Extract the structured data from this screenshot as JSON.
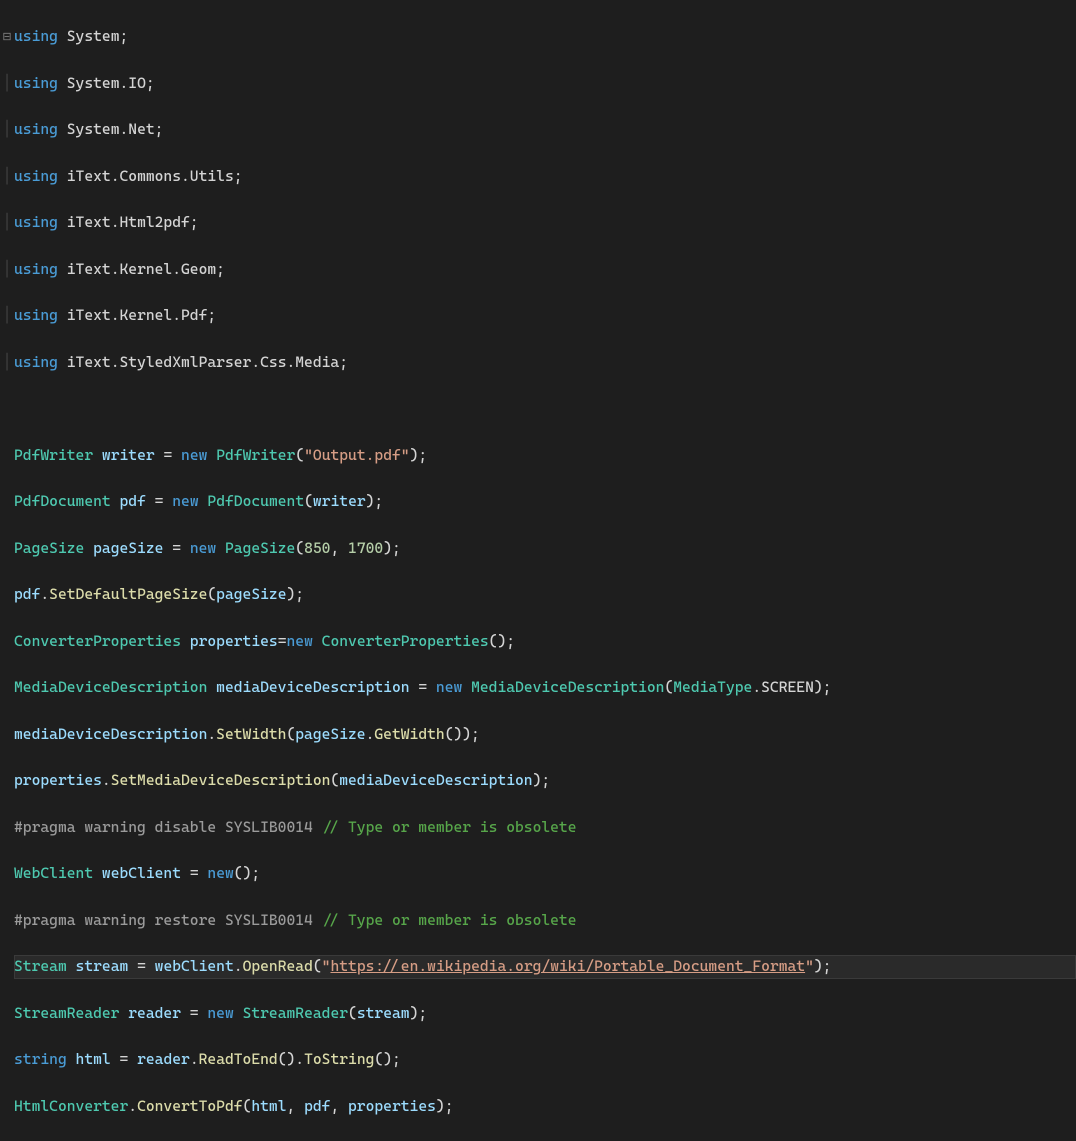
{
  "code": {
    "usings": [
      "System",
      "System.IO",
      "System.Net",
      "iText.Commons.Utils",
      "iText.Html2pdf",
      "iText.Kernel.Geom",
      "iText.Kernel.Pdf",
      "iText.StyledXmlParser.Css.Media"
    ],
    "kw_using": "using",
    "kw_new": "new",
    "kw_string": "string",
    "type_PdfWriter": "PdfWriter",
    "type_PdfDocument": "PdfDocument",
    "type_PageSize": "PageSize",
    "type_ConverterProperties": "ConverterProperties",
    "type_MediaDeviceDescription": "MediaDeviceDescription",
    "type_MediaType": "MediaType",
    "type_WebClient": "WebClient",
    "type_Stream": "Stream",
    "type_StreamReader": "StreamReader",
    "type_HtmlConverter": "HtmlConverter",
    "var_writer": "writer",
    "var_pdf": "pdf",
    "var_pageSize": "pageSize",
    "var_properties": "properties",
    "var_mediaDeviceDescription": "mediaDeviceDescription",
    "var_webClient": "webClient",
    "var_stream": "stream",
    "var_reader": "reader",
    "var_html": "html",
    "enum_SCREEN": "SCREEN",
    "m_SetDefaultPageSize": "SetDefaultPageSize",
    "m_SetWidth": "SetWidth",
    "m_GetWidth": "GetWidth",
    "m_SetMediaDeviceDescription": "SetMediaDeviceDescription",
    "m_OpenRead": "OpenRead",
    "m_ReadToEnd": "ReadToEnd",
    "m_ToString": "ToString",
    "m_ConvertToPdf": "ConvertToPdf",
    "str_output": "\"Output.pdf\"",
    "str_url": "https://en.wikipedia.org/wiki/Portable_Document_Format",
    "num_850": "850",
    "num_1700": "1700",
    "pragma_disable": "#pragma warning disable SYSLIB0014",
    "pragma_restore": "#pragma warning restore SYSLIB0014",
    "comment_obsolete": "// Type or member is obsolete"
  }
}
